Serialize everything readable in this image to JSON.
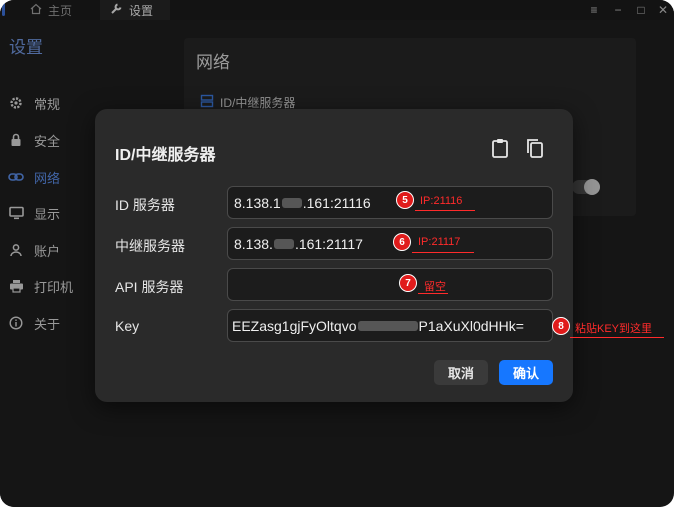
{
  "titlebar": {
    "home_tab": "主页",
    "settings_tab": "设置",
    "controls": [
      "≡",
      "−",
      "□",
      "✕"
    ]
  },
  "sidebar": {
    "title": "设置",
    "items": [
      {
        "label": "常规",
        "icon": "gear-icon"
      },
      {
        "label": "安全",
        "icon": "lock-icon"
      },
      {
        "label": "网络",
        "icon": "link-icon",
        "active": true
      },
      {
        "label": "显示",
        "icon": "monitor-icon"
      },
      {
        "label": "账户",
        "icon": "person-icon"
      },
      {
        "label": "打印机",
        "icon": "printer-icon"
      },
      {
        "label": "关于",
        "icon": "info-icon"
      }
    ]
  },
  "main": {
    "title": "网络",
    "subsection": "ID/中继服务器"
  },
  "dialog": {
    "title": "ID/中继服务器",
    "fields": [
      {
        "label": "ID 服务器",
        "value_prefix": "8.138.1",
        "value_suffix": ".161:21116"
      },
      {
        "label": "中继服务器",
        "value_prefix": "8.138.",
        "value_suffix": ".161:21117"
      },
      {
        "label": "API 服务器",
        "value_prefix": "",
        "value_suffix": ""
      },
      {
        "label": "Key",
        "value_prefix": "EEZasg1gjFyOltqvo",
        "value_suffix": "P1aXuXl0dHHk="
      }
    ],
    "cancel_label": "取消",
    "ok_label": "确认"
  },
  "annotations": [
    {
      "number": "5",
      "text": "IP:21116"
    },
    {
      "number": "6",
      "text": "IP:21117"
    },
    {
      "number": "7",
      "text": "留空"
    },
    {
      "number": "8",
      "text": "粘贴KEY到这里"
    }
  ],
  "colors": {
    "accent": "#1677ff",
    "sidebar_active": "#5b8de8",
    "annotation": "#e01b1b"
  }
}
